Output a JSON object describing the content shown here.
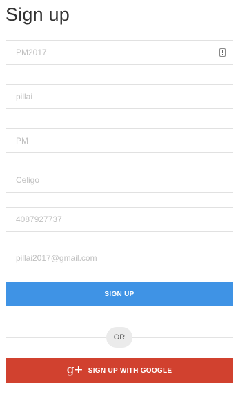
{
  "page": {
    "title": "Sign up"
  },
  "form": {
    "fields": [
      {
        "name": "username",
        "value": "PM2017",
        "icon": "contact-card-icon"
      },
      {
        "name": "last-name",
        "value": "pillai"
      },
      {
        "name": "first-name",
        "value": "PM"
      },
      {
        "name": "company",
        "value": "Celigo"
      },
      {
        "name": "phone",
        "value": "4087927737"
      },
      {
        "name": "email",
        "value": "pillai2017@gmail.com"
      }
    ],
    "signup_label": "SIGN UP",
    "divider_label": "OR",
    "google_glyph": "g+",
    "google_label": "SIGN UP WITH GOOGLE"
  },
  "colors": {
    "primary": "#3f93e5",
    "google": "#d1412f",
    "border": "#e1e1e1",
    "placeholder": "#c0c0c0"
  }
}
